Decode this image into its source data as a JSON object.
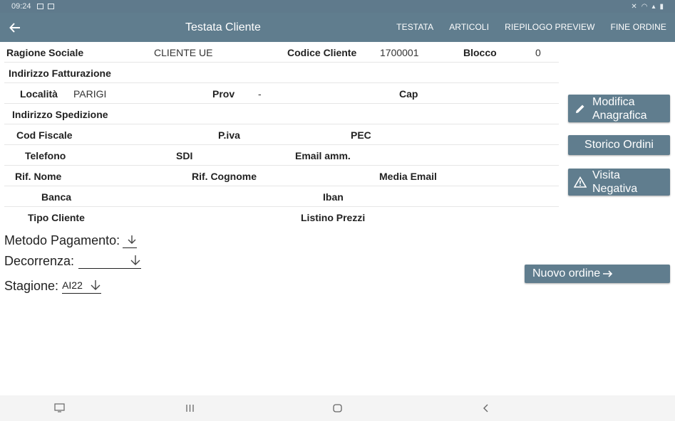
{
  "status": {
    "time": "09:24"
  },
  "appbar": {
    "title": "Testata Cliente",
    "actions": [
      "TESTATA",
      "ARTICOLI",
      "RIEPILOGO PREVIEW",
      "FINE ORDINE"
    ]
  },
  "form": {
    "ragione_sociale_label": "Ragione Sociale",
    "ragione_sociale_value": "CLIENTE UE",
    "codice_cliente_label": "Codice Cliente",
    "codice_cliente_value": "1700001",
    "blocco_label": "Blocco",
    "blocco_value": "0",
    "indirizzo_fatturazione_label": "Indirizzo Fatturazione",
    "localita_label": "Località",
    "localita_value": "PARIGI",
    "prov_label": "Prov",
    "prov_value": "-",
    "cap_label": "Cap",
    "indirizzo_spedizione_label": "Indirizzo Spedizione",
    "cod_fiscale_label": "Cod Fiscale",
    "piva_label": "P.iva",
    "pec_label": "PEC",
    "telefono_label": "Telefono",
    "sdi_label": "SDI",
    "email_amm_label": "Email amm.",
    "rif_nome_label": "Rif. Nome",
    "rif_cognome_label": "Rif. Cognome",
    "media_email_label": "Media Email",
    "banca_label": "Banca",
    "iban_label": "Iban",
    "tipo_cliente_label": "Tipo Cliente",
    "listino_prezzi_label": "Listino Prezzi"
  },
  "fields": {
    "metodo_pagamento_label": "Metodo Pagamento:",
    "metodo_pagamento_value": "",
    "decorrenza_label": "Decorrenza:",
    "decorrenza_value": "",
    "stagione_label": "Stagione:",
    "stagione_value": "AI22"
  },
  "buttons": {
    "modifica_anagrafica_line1": "Modifica",
    "modifica_anagrafica_line2": "Anagrafica",
    "storico_ordini": "Storico Ordini",
    "visita_negativa_line1": "Visita",
    "visita_negativa_line2": "Negativa",
    "nuovo_ordine": "Nuovo ordine"
  },
  "icons": {
    "back": "arrow-left-icon",
    "edit": "pencil-icon",
    "warning": "warning-triangle-icon",
    "arrow_right": "arrow-right-icon",
    "dropdown": "arrow-down-icon"
  },
  "colors": {
    "appbar": "#607d8e",
    "statusbar": "#5f7a8c",
    "button": "#607d8e"
  }
}
